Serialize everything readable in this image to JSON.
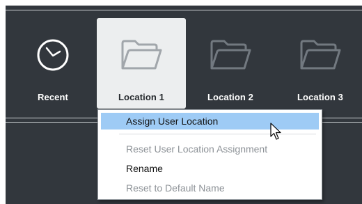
{
  "locations": [
    {
      "label": "Recent",
      "icon": "clock-icon",
      "selected": false
    },
    {
      "label": "Location 1",
      "icon": "folder-icon",
      "selected": true
    },
    {
      "label": "Location 2",
      "icon": "folder-icon",
      "selected": false
    },
    {
      "label": "Location 3",
      "icon": "folder-icon",
      "selected": false
    }
  ],
  "context_menu": {
    "items": [
      {
        "label": "Assign User Location",
        "state": "highlighted"
      },
      {
        "label": "Reset User Location Assignment",
        "state": "disabled"
      },
      {
        "label": "Rename",
        "state": "enabled"
      },
      {
        "label": "Reset to Default Name",
        "state": "disabled"
      }
    ]
  },
  "colors": {
    "panel_bg": "#32373d",
    "selected_bg": "#eceeef",
    "menu_highlight": "#9ecbf5",
    "disabled_text": "#8d9297"
  }
}
